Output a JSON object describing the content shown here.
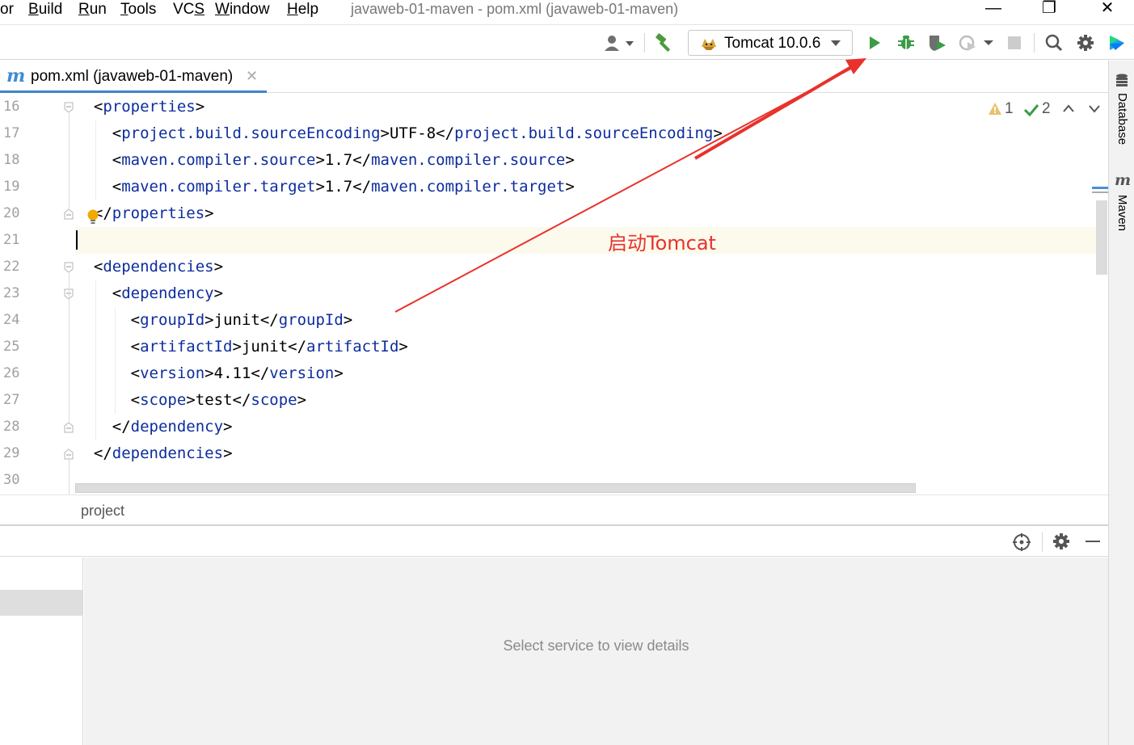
{
  "menubar": {
    "items": [
      {
        "label": "or",
        "mnemonic": ""
      },
      {
        "label": "Build",
        "mnemonic": "B"
      },
      {
        "label": "Run",
        "mnemonic": "R"
      },
      {
        "label": "Tools",
        "mnemonic": "T"
      },
      {
        "label": "VCS",
        "mnemonic": "S"
      },
      {
        "label": "Window",
        "mnemonic": "W"
      },
      {
        "label": "Help",
        "mnemonic": "H"
      }
    ],
    "window_title": "javaweb-01-maven - pom.xml (javaweb-01-maven)",
    "controls": {
      "minimize": "—",
      "restore": "❐",
      "close": "✕"
    }
  },
  "toolbar": {
    "run_config_label": "Tomcat 10.0.6",
    "icons": [
      "user-icon",
      "build-hammer-icon",
      "tomcat-icon",
      "run-icon",
      "debug-icon",
      "coverage-icon",
      "profile-icon",
      "stop-icon",
      "search-icon",
      "settings-icon",
      "jetbrains-logo-icon"
    ],
    "colors": {
      "run": "#3b9c45",
      "debug": "#3b9c45"
    }
  },
  "tabs": [
    {
      "label": "pom.xml (javaweb-01-maven)",
      "close": "✕",
      "icon": "maven-icon"
    }
  ],
  "right_strip": {
    "database_label": "Database",
    "maven_label": "Maven",
    "maven_icon_text": "m"
  },
  "editor": {
    "inspections": {
      "warnings": "1",
      "ok": "2"
    },
    "current_line": 21,
    "lines": [
      {
        "num": "16",
        "indent": "  ",
        "open": "<",
        "name": "properties",
        "close": ">",
        "text": "",
        "end_open": "",
        "end_name": "",
        "end_close": ""
      },
      {
        "num": "17",
        "indent": "    ",
        "open": "<",
        "name": "project.build.sourceEncoding",
        "close": ">",
        "text": "UTF-8",
        "end_open": "</",
        "end_name": "project.build.sourceEncoding",
        "end_close": ">"
      },
      {
        "num": "18",
        "indent": "    ",
        "open": "<",
        "name": "maven.compiler.source",
        "close": ">",
        "text": "1.7",
        "end_open": "</",
        "end_name": "maven.compiler.source",
        "end_close": ">"
      },
      {
        "num": "19",
        "indent": "    ",
        "open": "<",
        "name": "maven.compiler.target",
        "close": ">",
        "text": "1.7",
        "end_open": "</",
        "end_name": "maven.compiler.target",
        "end_close": ">"
      },
      {
        "num": "20",
        "indent": "  ",
        "open": "</",
        "name": "properties",
        "close": ">",
        "text": "",
        "end_open": "",
        "end_name": "",
        "end_close": ""
      },
      {
        "num": "21",
        "indent": "",
        "open": "",
        "name": "",
        "close": "",
        "text": "",
        "end_open": "",
        "end_name": "",
        "end_close": ""
      },
      {
        "num": "22",
        "indent": "  ",
        "open": "<",
        "name": "dependencies",
        "close": ">",
        "text": "",
        "end_open": "",
        "end_name": "",
        "end_close": ""
      },
      {
        "num": "23",
        "indent": "    ",
        "open": "<",
        "name": "dependency",
        "close": ">",
        "text": "",
        "end_open": "",
        "end_name": "",
        "end_close": ""
      },
      {
        "num": "24",
        "indent": "      ",
        "open": "<",
        "name": "groupId",
        "close": ">",
        "text": "junit",
        "end_open": "</",
        "end_name": "groupId",
        "end_close": ">"
      },
      {
        "num": "25",
        "indent": "      ",
        "open": "<",
        "name": "artifactId",
        "close": ">",
        "text": "junit",
        "end_open": "</",
        "end_name": "artifactId",
        "end_close": ">"
      },
      {
        "num": "26",
        "indent": "      ",
        "open": "<",
        "name": "version",
        "close": ">",
        "text": "4.11",
        "end_open": "</",
        "end_name": "version",
        "end_close": ">"
      },
      {
        "num": "27",
        "indent": "      ",
        "open": "<",
        "name": "scope",
        "close": ">",
        "text": "test",
        "end_open": "</",
        "end_name": "scope",
        "end_close": ">"
      },
      {
        "num": "28",
        "indent": "    ",
        "open": "</",
        "name": "dependency",
        "close": ">",
        "text": "",
        "end_open": "",
        "end_name": "",
        "end_close": ""
      },
      {
        "num": "29",
        "indent": "  ",
        "open": "</",
        "name": "dependencies",
        "close": ">",
        "text": "",
        "end_open": "",
        "end_name": "",
        "end_close": ""
      },
      {
        "num": "30",
        "indent": "",
        "open": "",
        "name": "",
        "close": "",
        "text": "",
        "end_open": "",
        "end_name": "",
        "end_close": ""
      }
    ]
  },
  "breadcrumb": {
    "label": "project"
  },
  "services": {
    "empty_text": "Select service to view details"
  },
  "annotation": {
    "text": "启动Tomcat",
    "color": "#e8322b"
  }
}
